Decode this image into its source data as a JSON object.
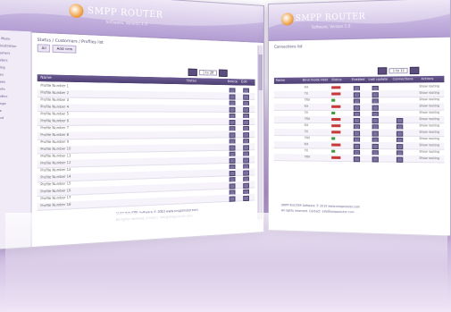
{
  "brand": {
    "name": "SMPP ROUTER",
    "sublabel": "Software, Version 1.0"
  },
  "left_window": {
    "breadcrumb": "Status / Customers / Profiles list",
    "tabs": [
      "All",
      "Add new"
    ],
    "pager": {
      "page_label": "1 to 20"
    },
    "columns": [
      "Name",
      "Status",
      "Delete",
      "Edit"
    ],
    "sidebar_items": [
      "Main Menu",
      "Administration",
      "Customers",
      "Suppliers",
      "Routing",
      "Routes",
      "Prefixes",
      "Reports",
      "Statistics",
      "Settings",
      "Users",
      "Logout"
    ],
    "rows": [
      {
        "name": "Profile Number 1"
      },
      {
        "name": "Profile Number 2"
      },
      {
        "name": "Profile Number 3"
      },
      {
        "name": "Profile Number 4"
      },
      {
        "name": "Profile Number 5"
      },
      {
        "name": "Profile Number 6"
      },
      {
        "name": "Profile Number 7"
      },
      {
        "name": "Profile Number 8"
      },
      {
        "name": "Profile Number 9"
      },
      {
        "name": "Profile Number 10"
      },
      {
        "name": "Profile Number 11"
      },
      {
        "name": "Profile Number 12"
      },
      {
        "name": "Profile Number 13"
      },
      {
        "name": "Profile Number 14"
      },
      {
        "name": "Profile Number 15"
      },
      {
        "name": "Profile Number 16"
      },
      {
        "name": "Profile Number 17"
      },
      {
        "name": "Profile Number 18"
      }
    ],
    "footer": [
      "SMPP ROUTER Software © 2010 www.smpprouter.com",
      "All rights reserved. Contact: info@smpprouter.com"
    ]
  },
  "right_window": {
    "breadcrumb": "Connections list",
    "pager": {
      "page_label": "1 to 12"
    },
    "columns": [
      "Name",
      "Bind mode",
      "Host",
      "Status",
      "Enabled",
      "Last update",
      "Connections",
      "Actions"
    ],
    "rows": [
      {
        "mode": "RX",
        "status": "red",
        "label": "Show routing"
      },
      {
        "mode": "TX",
        "status": "red",
        "label": "Show routing"
      },
      {
        "mode": "TRX",
        "status": "green",
        "label": "Show routing"
      },
      {
        "mode": "RX",
        "status": "red",
        "label": "Show routing"
      },
      {
        "mode": "TX",
        "status": "green",
        "label": "Show routing"
      },
      {
        "mode": "TRX",
        "status": "red",
        "label": "Show routing"
      },
      {
        "mode": "RX",
        "status": "red",
        "label": "Show routing"
      },
      {
        "mode": "TX",
        "status": "red",
        "label": "Show routing"
      },
      {
        "mode": "TRX",
        "status": "green",
        "label": "Show routing"
      },
      {
        "mode": "RX",
        "status": "red",
        "label": "Show routing"
      },
      {
        "mode": "TX",
        "status": "green",
        "label": "Show routing"
      },
      {
        "mode": "TRX",
        "status": "red",
        "label": "Show routing"
      }
    ],
    "footer": [
      "SMPP ROUTER Software © 2010 www.smpprouter.com",
      "All rights reserved. Contact: info@smpprouter.com"
    ]
  },
  "colors": {
    "accent": "#5c4f80",
    "header": "#b39ed2",
    "status_red": "#c63a3a",
    "status_green": "#3a9b3a",
    "background": "#b69ad0"
  }
}
